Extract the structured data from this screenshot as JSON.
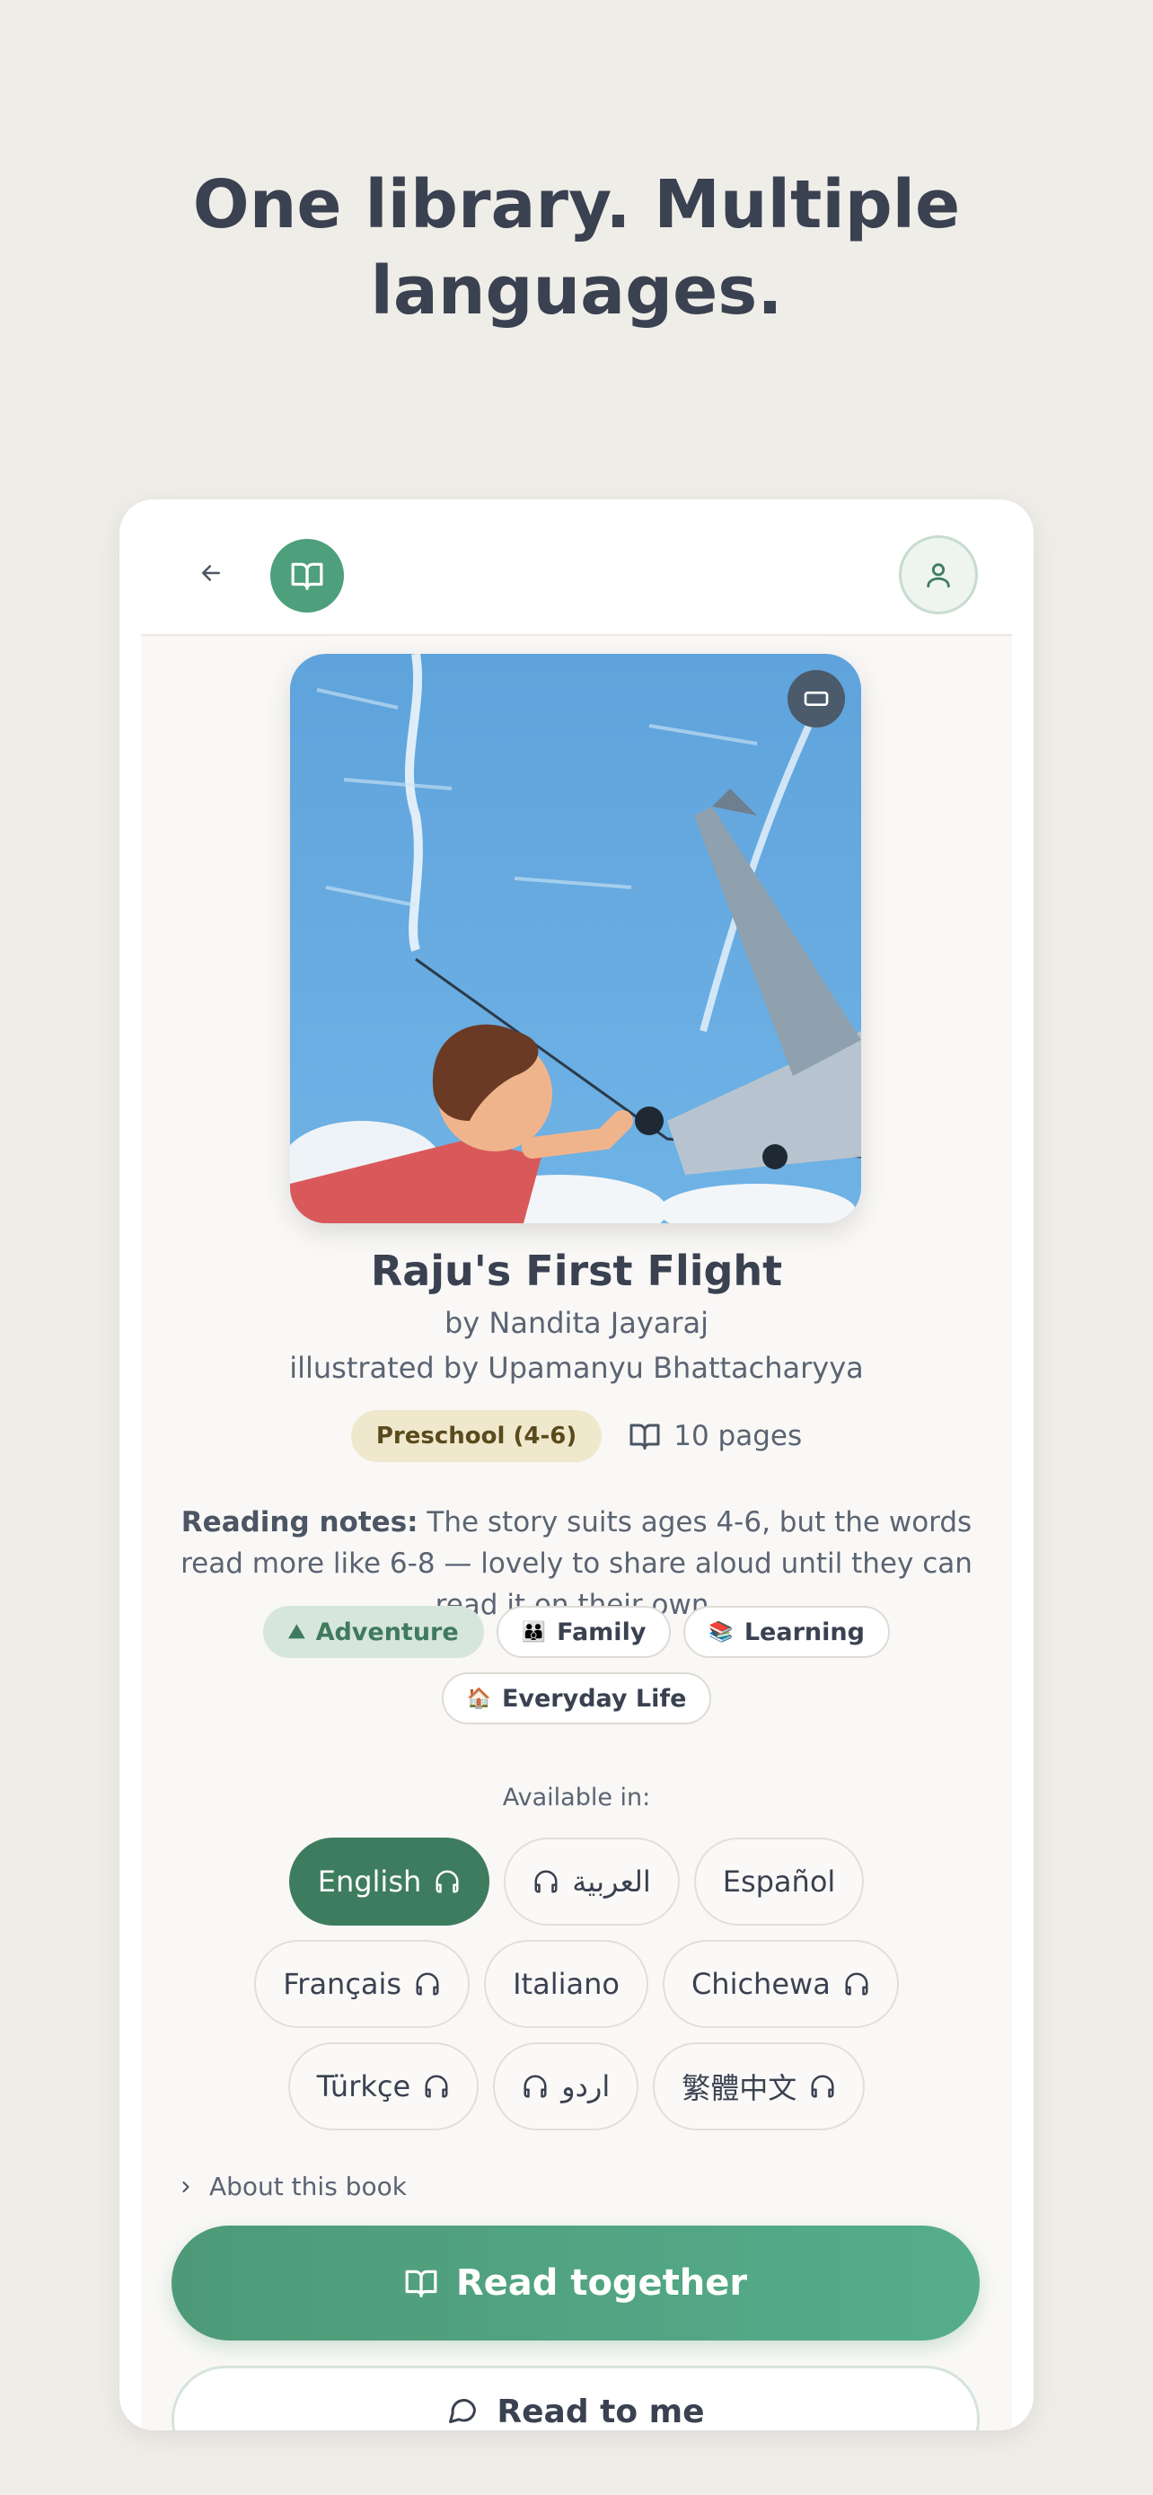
{
  "headline": "One library. Multiple languages.",
  "book": {
    "title": "Raju's First Flight",
    "author": "by Nandita Jayaraj",
    "illustrator": "illustrated by Upamanyu Bhattacharyya",
    "age_badge": "Preschool (4-6)",
    "pages": "10 pages",
    "notes_label": "Reading notes:",
    "notes_text": " The story suits ages 4-6, but the words read more like 6-8 — lovely to share aloud until they can read it on their own."
  },
  "tags": [
    {
      "emoji": "⛰",
      "label": "Adventure",
      "active": true
    },
    {
      "emoji": "👪",
      "label": "Family",
      "active": false
    },
    {
      "emoji": "📚",
      "label": "Learning",
      "active": false
    },
    {
      "emoji": "🏠",
      "label": "Everyday Life",
      "active": false
    }
  ],
  "available_label": "Available in:",
  "languages": [
    {
      "label": "English",
      "audio": true,
      "selected": true,
      "rtl": false
    },
    {
      "label": "العربية",
      "audio": true,
      "selected": false,
      "rtl": true
    },
    {
      "label": "Español",
      "audio": false,
      "selected": false,
      "rtl": false
    },
    {
      "label": "Français",
      "audio": true,
      "selected": false,
      "rtl": false
    },
    {
      "label": "Italiano",
      "audio": false,
      "selected": false,
      "rtl": false
    },
    {
      "label": "Chichewa",
      "audio": true,
      "selected": false,
      "rtl": false
    },
    {
      "label": "Türkçe",
      "audio": true,
      "selected": false,
      "rtl": false
    },
    {
      "label": "اردو",
      "audio": true,
      "selected": false,
      "rtl": true
    },
    {
      "label": "繁體中文",
      "audio": true,
      "selected": false,
      "rtl": false
    }
  ],
  "about_label": "About this book",
  "buttons": {
    "read_together": "Read together",
    "read_to_me": "Read to me"
  },
  "colors": {
    "accent": "#4e9f7c",
    "selected_language": "#3e7c5f",
    "background": "#efede8"
  },
  "icons": {
    "back": "arrow-left-icon",
    "logo": "book-open-icon",
    "profile": "user-icon",
    "cover_badge": "landscape-view-icon",
    "pages": "book-open-icon",
    "audio": "headphones-icon",
    "about": "chevron-right-icon",
    "read_to_me": "speech-bubble-icon"
  }
}
